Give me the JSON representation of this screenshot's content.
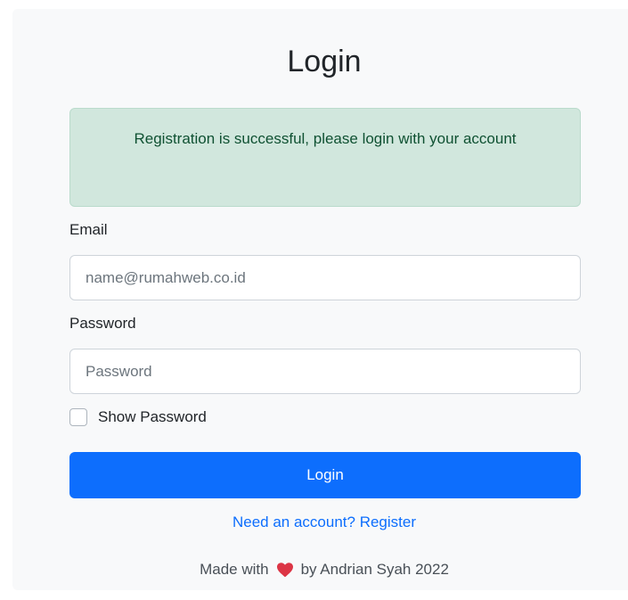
{
  "login": {
    "title": "Login",
    "alert_message": "Registration is successful, please login with your account",
    "email_label": "Email",
    "email_placeholder": "name@rumahweb.co.id",
    "email_value": "",
    "password_label": "Password",
    "password_placeholder": "Password",
    "password_value": "",
    "show_password_label": "Show Password",
    "show_password_checked": false,
    "submit_label": "Login",
    "register_link": "Need an account? Register",
    "footer_before": "Made with",
    "footer_after": "by Andrian Syah 2022",
    "heart_icon": "heart-icon"
  },
  "colors": {
    "primary": "#0d6efd",
    "alert_bg": "#d1e7dd",
    "alert_text": "#0f5132",
    "heart": "#dc3545"
  }
}
